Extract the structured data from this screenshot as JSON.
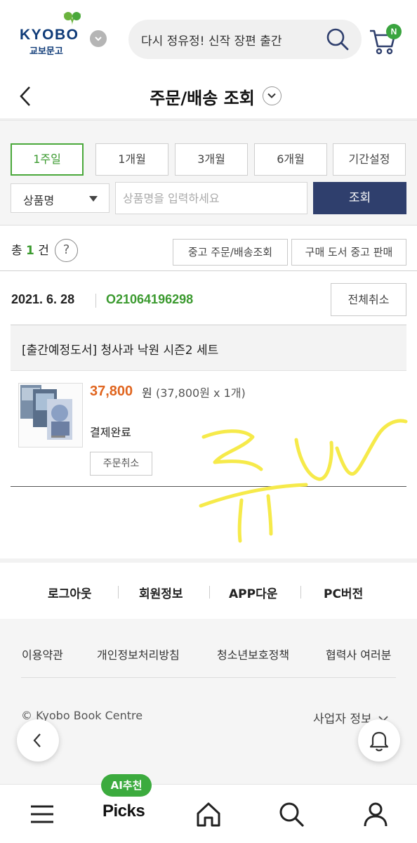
{
  "header": {
    "logo_text": "KYOBO",
    "logo_sub": "교보문고",
    "search_value": "다시 정유정! 신작 장편 출간",
    "cart_badge": "N"
  },
  "titlebar": {
    "title": "주문/배송 조회"
  },
  "filter": {
    "periods": [
      {
        "label": "1주일",
        "active": true
      },
      {
        "label": "1개월",
        "active": false
      },
      {
        "label": "3개월",
        "active": false
      },
      {
        "label": "6개월",
        "active": false
      },
      {
        "label": "기간설정",
        "active": false
      }
    ],
    "select_value": "상품명",
    "input_placeholder": "상품명을 입력하세요",
    "query_label": "조회"
  },
  "summary": {
    "count_prefix": "총",
    "count": "1",
    "count_suffix": "건",
    "help_label": "?",
    "used_order_label": "중고 주문/배송조회",
    "sell_used_label": "구매 도서 중고 판매"
  },
  "order": {
    "date": "2021. 6. 28",
    "order_no": "O21064196298",
    "cancel_all_label": "전체취소",
    "product_title": "[출간예정도서] 청사과 낙원 시즌2 세트",
    "price": "37,800",
    "price_unit": "원",
    "price_detail": "(37,800원 x 1개)",
    "status": "결제완료",
    "cancel_label": "주문취소"
  },
  "footer": {
    "links": [
      "로그아웃",
      "회원정보",
      "APP다운",
      "PC버전"
    ],
    "policies": [
      "이용약관",
      "개인정보처리방침",
      "청소년보호정책",
      "협력사 여러분"
    ],
    "copyright": "© Kyobo Book Centre",
    "business_info": "사업자 정보"
  },
  "bottom_nav": {
    "ai_badge": "AI추천",
    "picks_label": "Picks"
  },
  "colors": {
    "brand_green": "#3b9a2f",
    "brand_navy": "#2f3f6d",
    "price_orange": "#e0651f",
    "scribble_yellow": "#f6ea4a"
  }
}
